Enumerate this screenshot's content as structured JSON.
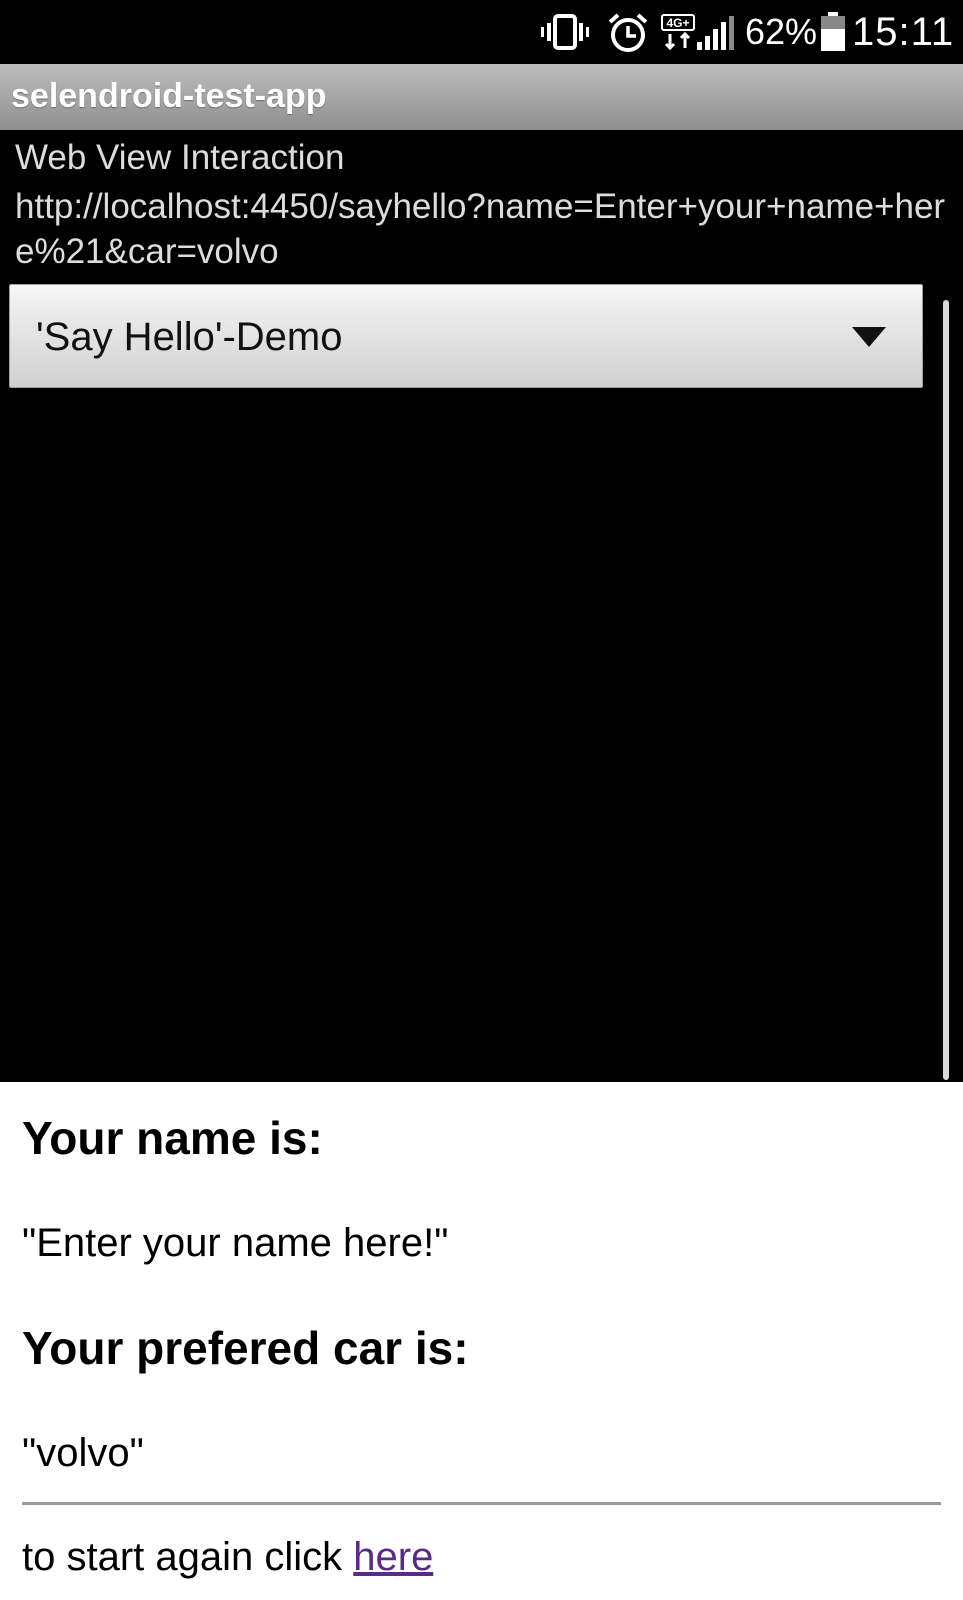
{
  "status_bar": {
    "battery_percent": "62%",
    "time": "15:11",
    "network_type": "4G+",
    "icons": [
      "vibrate-icon",
      "alarm-icon",
      "network-icon",
      "signal-icon",
      "battery-icon"
    ]
  },
  "app": {
    "title": "selendroid-test-app"
  },
  "activity": {
    "label": "Web View Interaction",
    "url": "http://localhost:4450/sayhello?name=Enter+your+name+here%21&car=volvo"
  },
  "spinner": {
    "selected": "'Say Hello'-Demo"
  },
  "web_view": {
    "name_heading": "Your name is:",
    "name_value": "\"Enter your name here!\"",
    "car_heading": "Your prefered car is:",
    "car_value": "\"volvo\"",
    "restart_prefix": "to start again click ",
    "restart_link": "here"
  },
  "colors": {
    "background": "#000000",
    "title_bar": "#a8a8a8",
    "link": "#5a2a8a",
    "web_view_bg": "#ffffff"
  }
}
